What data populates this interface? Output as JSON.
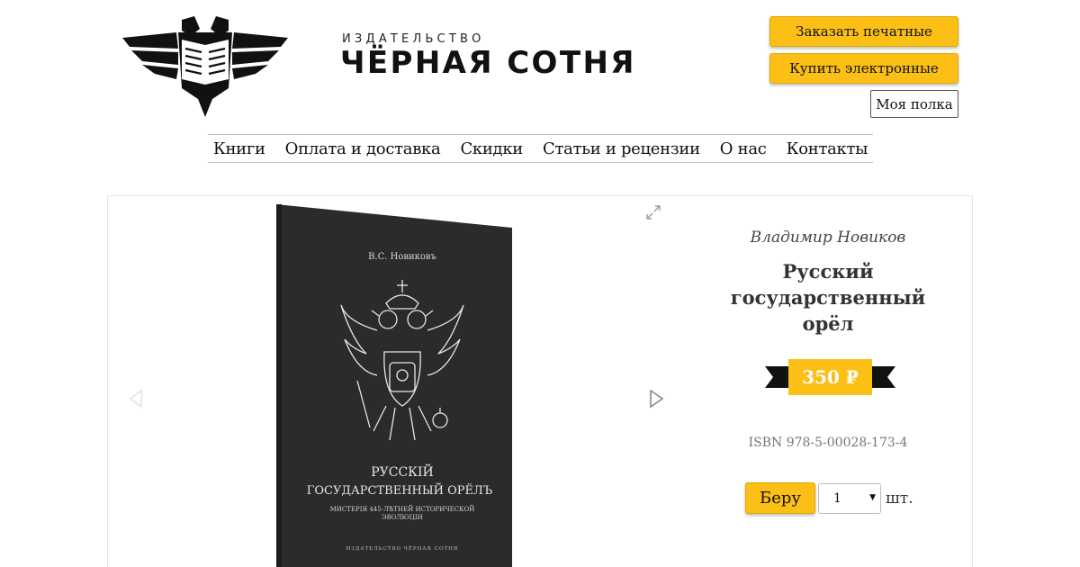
{
  "brand": {
    "small": "ИЗДАТЕЛЬСТВО",
    "big": "ЧЁРНАЯ СОТНЯ"
  },
  "header": {
    "order_print_label": "Заказать печатные",
    "buy_electronic_label": "Купить электронные",
    "my_shelf_label": "Моя полка"
  },
  "nav": {
    "items": [
      "Книги",
      "Оплата и доставка",
      "Скидки",
      "Статьи и рецензии",
      "О нас",
      "Контакты"
    ]
  },
  "product": {
    "author": "Владимир Новиков",
    "title_line1": "Русский государственный",
    "title_line2": "орёл",
    "price": "350 ₽",
    "isbn": "ISBN 978-5-00028-173-4",
    "take_label": "Беру",
    "quantity": "1",
    "unit": "шт."
  },
  "cover": {
    "author": "В.С. Новиковъ",
    "title_line1": "РУССКІЙ",
    "title_line2": "ГОСУДАРСТВЕННЫЙ ОРЁЛЪ",
    "subtitle_line1": "МИСТЕРІЯ 445-ЛѢТНЕЙ ИСТОРИЧЕСКОЙ",
    "subtitle_line2": "ЭВОЛЮЦІИ",
    "publisher": "ИЗДАТЕЛЬСТВО ЧЁРНАЯ СОТНЯ"
  },
  "colors": {
    "accent": "#fcbf16",
    "ribbon": "#111111",
    "cover": "#2b2b2b"
  },
  "icons": {
    "expand": "expand-icon",
    "prev": "arrow-left-icon",
    "next": "arrow-right-icon",
    "emblem": "eagle-book-logo-icon"
  }
}
